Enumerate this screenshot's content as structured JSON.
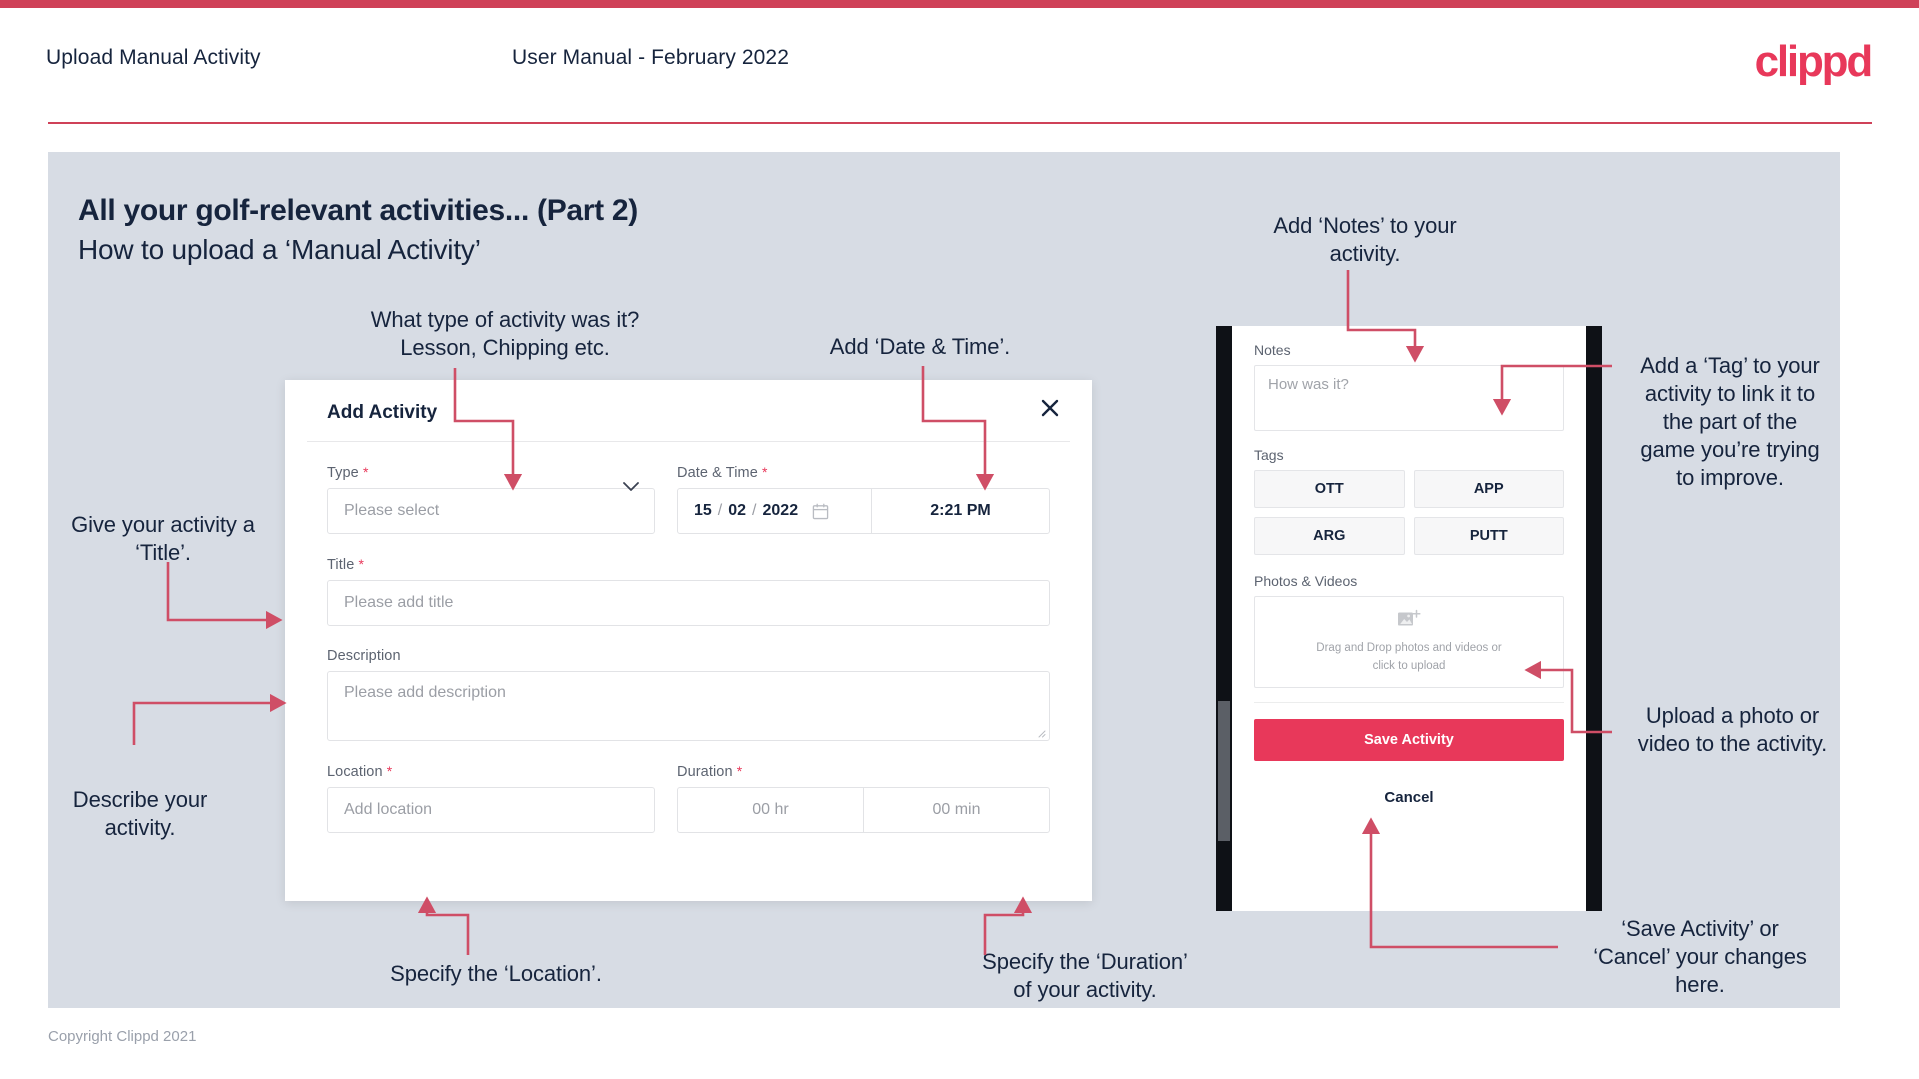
{
  "header": {
    "title": "Upload Manual Activity",
    "subtitle": "User Manual - February 2022",
    "logo": "clippd"
  },
  "slide": {
    "title": "All your golf-relevant activities... (Part 2)",
    "subtitle": "How to upload a ‘Manual Activity’"
  },
  "footer": {
    "copyright": "Copyright Clippd 2021"
  },
  "modal": {
    "title": "Add Activity",
    "close_icon": "close-icon",
    "fields": {
      "type": {
        "label": "Type",
        "required": "*",
        "placeholder": "Please select"
      },
      "datetime": {
        "label": "Date & Time",
        "required": "*",
        "day": "15",
        "month": "02",
        "year": "2022",
        "sep": "/",
        "time": "2:21 PM"
      },
      "title": {
        "label": "Title",
        "required": "*",
        "placeholder": "Please add title"
      },
      "description": {
        "label": "Description",
        "placeholder": "Please add description"
      },
      "location": {
        "label": "Location",
        "required": "*",
        "placeholder": "Add location"
      },
      "duration": {
        "label": "Duration",
        "required": "*",
        "hours": "00 hr",
        "minutes": "00 min"
      }
    }
  },
  "mobile": {
    "notes": {
      "label": "Notes",
      "placeholder": "How was it?"
    },
    "tags": {
      "label": "Tags",
      "items": [
        "OTT",
        "APP",
        "ARG",
        "PUTT"
      ]
    },
    "photos": {
      "label": "Photos & Videos",
      "drop_line1": "Drag and Drop photos and videos or",
      "drop_line2": "click to upload",
      "icon": "add-image-icon"
    },
    "save_label": "Save Activity",
    "cancel_label": "Cancel"
  },
  "annotations": {
    "type": "What type of activity was it?\nLesson, Chipping etc.",
    "datetime": "Add ‘Date & Time’.",
    "title": "Give your activity a\n‘Title’.",
    "description": "Describe your\nactivity.",
    "location": "Specify the ‘Location’.",
    "duration": "Specify the ‘Duration’\nof your activity.",
    "notes": "Add ‘Notes’ to your\nactivity.",
    "tags": "Add a ‘Tag’ to your\nactivity to link it to\nthe part of the\ngame you’re trying\nto improve.",
    "photos": "Upload a photo or\nvideo to the activity.",
    "save": "‘Save Activity’ or\n‘Cancel’ your changes\nhere."
  },
  "colors": {
    "accent": "#e8385a",
    "bar": "#cf4158",
    "slide_bg": "#d7dce4",
    "text": "#16243d",
    "arrow": "#cf4e66"
  }
}
